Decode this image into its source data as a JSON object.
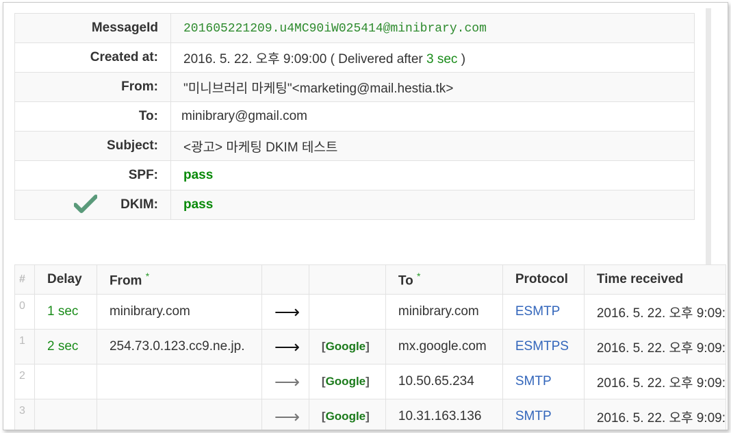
{
  "info": {
    "message_id": {
      "label": "MessageId",
      "value": "201605221209.u4MC90iW025414@minibrary.com"
    },
    "created": {
      "label": "Created at:",
      "value": "2016. 5. 22. 오후 9:09:00",
      "delivered_prefix": "( Delivered after",
      "delivered_value": "3 sec",
      "delivered_suffix": ")"
    },
    "from": {
      "label": "From:",
      "value": "\"미니브러리 마케팅\"<marketing@mail.hestia.tk>"
    },
    "to": {
      "label": "To:",
      "value": "minibrary@gmail.com"
    },
    "subject": {
      "label": "Subject:",
      "value": "<광고> 마케팅 DKIM 테스트"
    },
    "spf": {
      "label": "SPF:",
      "value": "pass"
    },
    "dkim": {
      "label": "DKIM:",
      "value": "pass",
      "icon": "checkmark-icon"
    }
  },
  "hops": {
    "headers": {
      "index": "#",
      "delay": "Delay",
      "from": "From",
      "from_star": "*",
      "to": "To",
      "to_star": "*",
      "protocol": "Protocol",
      "time": "Time received"
    },
    "rows": [
      {
        "index": "0",
        "delay": "1 sec",
        "from": "minibrary.com",
        "arrow": "⟶",
        "tag": "",
        "to": "minibrary.com",
        "protocol": "ESMTP",
        "time": "2016. 5. 22. 오후 9:09:"
      },
      {
        "index": "1",
        "delay": "2 sec",
        "from": "254.73.0.123.cc9.ne.jp.",
        "arrow": "⟶",
        "tag": "Google",
        "to": "mx.google.com",
        "protocol": "ESMTPS",
        "time": "2016. 5. 22. 오후 9:09:"
      },
      {
        "index": "2",
        "delay": "",
        "from": "",
        "arrow": "⟶",
        "tag": "Google",
        "to": "10.50.65.234",
        "protocol": "SMTP",
        "time": "2016. 5. 22. 오후 9:09:"
      },
      {
        "index": "3",
        "delay": "",
        "from": "",
        "arrow": "⟶",
        "tag": "Google",
        "to": "10.31.163.136",
        "protocol": "SMTP",
        "time": "2016. 5. 22. 오후 9:09:"
      }
    ],
    "tag_open": "[",
    "tag_close": "]"
  },
  "colors": {
    "green": "#1a8c1a",
    "blue": "#3366bb",
    "pass": "#0a8a0a"
  }
}
